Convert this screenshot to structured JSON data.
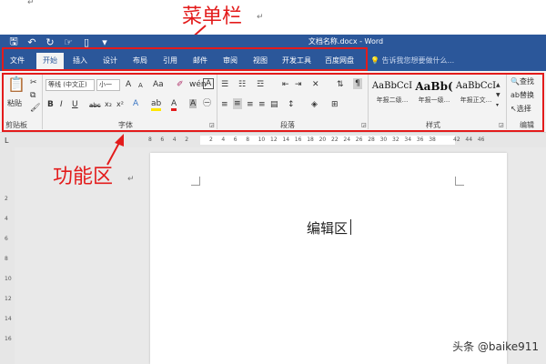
{
  "annotations": {
    "menu_bar": "菜单栏",
    "ribbon": "功能区",
    "edit_area": "编辑区",
    "color": "#e31b1b"
  },
  "window": {
    "title": "文档名称.docx - Word",
    "qat_icons": [
      "save-icon",
      "undo-icon",
      "redo-icon",
      "touch-mode-icon",
      "new-document-icon",
      "customize-qat-icon"
    ]
  },
  "tabs": [
    {
      "label": "文件",
      "active": false
    },
    {
      "label": "开始",
      "active": true
    },
    {
      "label": "插入",
      "active": false
    },
    {
      "label": "设计",
      "active": false
    },
    {
      "label": "布局",
      "active": false
    },
    {
      "label": "引用",
      "active": false
    },
    {
      "label": "邮件",
      "active": false
    },
    {
      "label": "审阅",
      "active": false
    },
    {
      "label": "视图",
      "active": false
    },
    {
      "label": "开发工具",
      "active": false
    },
    {
      "label": "百度网盘",
      "active": false
    }
  ],
  "tell_me": "告诉我您想要做什么...",
  "ribbon": {
    "clipboard": {
      "label": "剪贴板",
      "paste": "粘贴"
    },
    "font": {
      "label": "字体",
      "font_name": "等线 (中文正)",
      "font_size": "小一",
      "grow": "A",
      "shrink": "A",
      "change_case": "Aa",
      "bold": "B",
      "italic": "I",
      "underline": "U",
      "strike": "abc",
      "subscript": "x₂",
      "superscript": "x²"
    },
    "paragraph": {
      "label": "段落"
    },
    "styles": {
      "label": "样式",
      "items": [
        {
          "sample": "AaBbCcI",
          "name": "年报二级..."
        },
        {
          "sample": "AaBb(",
          "name": "年报一级..."
        },
        {
          "sample": "AaBbCcI",
          "name": "年报正文..."
        }
      ]
    },
    "editing": {
      "label": "编辑",
      "find": "查找",
      "replace": "替换",
      "select": "选择"
    }
  },
  "ruler": {
    "h_ticks": [
      "8",
      "6",
      "4",
      "2",
      "",
      "2",
      "4",
      "6",
      "8",
      "10",
      "12",
      "14",
      "16",
      "18",
      "20",
      "22",
      "24",
      "26",
      "28",
      "30",
      "32",
      "34",
      "36",
      "38",
      "",
      "42",
      "44",
      "46"
    ],
    "v_ticks": [
      "2",
      "4",
      "6",
      "8",
      "10",
      "12",
      "14",
      "16"
    ]
  },
  "document": {
    "body_text": "编辑区"
  },
  "watermark": "头条 @baike911"
}
